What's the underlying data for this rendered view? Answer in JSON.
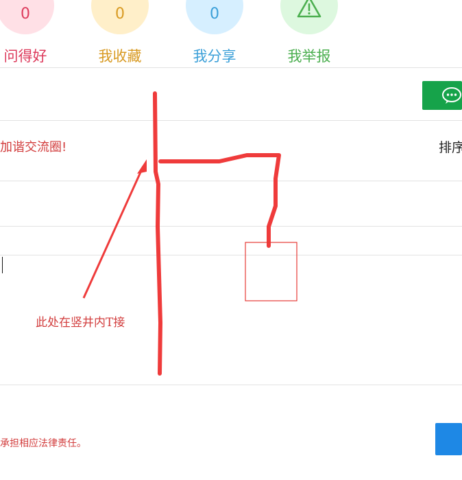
{
  "stats": [
    {
      "count": "0",
      "label": "问得好",
      "color": "#dd3b5c",
      "bg": "#ffe0e6"
    },
    {
      "count": "0",
      "label": "我收藏",
      "color": "#d89a22",
      "bg": "#ffefc9"
    },
    {
      "count": "0",
      "label": "我分享",
      "color": "#3a9fd8",
      "bg": "#d6efff"
    },
    {
      "count": "",
      "label": "我举报",
      "color": "#4caf50",
      "bg": "#ddf8df"
    }
  ],
  "intro": "加谐交流圈!",
  "sort_label": "排序",
  "annotation": "此处在竖井内T接",
  "disclaimer": "承担相应法律责任。",
  "colors": {
    "accent_red": "#e53935",
    "wechat_green": "#16a34a",
    "submit_blue": "#1e88e5"
  },
  "icons": {
    "wechat": "wechat-icon",
    "warning": "warning-icon"
  }
}
